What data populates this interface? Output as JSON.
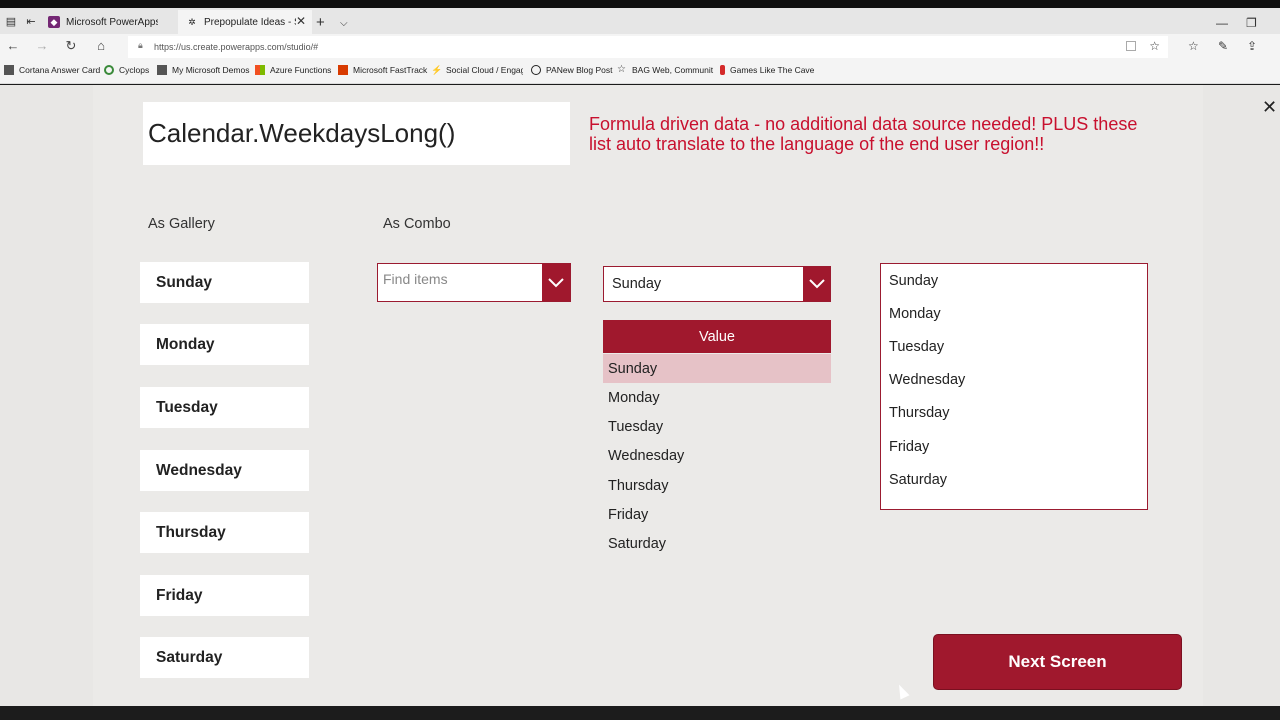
{
  "browser": {
    "tabs": [
      {
        "title": "Microsoft PowerApps",
        "active": false,
        "favicon_color": "#742774"
      },
      {
        "title": "Prepopulate Ideas - Sav",
        "active": true,
        "favicon_color": "#222222"
      }
    ],
    "url": "https://us.create.powerapps.com/studio/#",
    "favorites": [
      {
        "label": "Cortana Answer Card",
        "icon": "folder-icon"
      },
      {
        "label": "Cyclops",
        "icon": "circle-icon"
      },
      {
        "label": "My Microsoft Demos",
        "icon": "folder-icon"
      },
      {
        "label": "Azure Functions",
        "icon": "windows-logo-icon"
      },
      {
        "label": "Microsoft FastTrack",
        "icon": "office-icon"
      },
      {
        "label": "Social Cloud / Engage",
        "icon": "link-icon"
      },
      {
        "label": "PANew Blog Post",
        "icon": "wordpress-icon"
      },
      {
        "label": "BAG Web, Communit",
        "icon": "star-icon"
      },
      {
        "label": "Games Like The Cave",
        "icon": "bookmark-icon"
      }
    ]
  },
  "app": {
    "formula": "Calendar.WeekdaysLong()",
    "note": "Formula driven data - no additional data source needed! PLUS these list auto translate to the language of the end user region!!",
    "gallery_label": "As Gallery",
    "combo_label": "As Combo",
    "weekdays": [
      "Sunday",
      "Monday",
      "Tuesday",
      "Wednesday",
      "Thursday",
      "Friday",
      "Saturday"
    ],
    "combo_placeholder": "Find items",
    "dropdown_value": "Sunday",
    "table_header": "Value",
    "table_selected": "Sunday",
    "next_button": "Next Screen",
    "accent_color": "#a0182d",
    "note_color": "#c8102e"
  }
}
